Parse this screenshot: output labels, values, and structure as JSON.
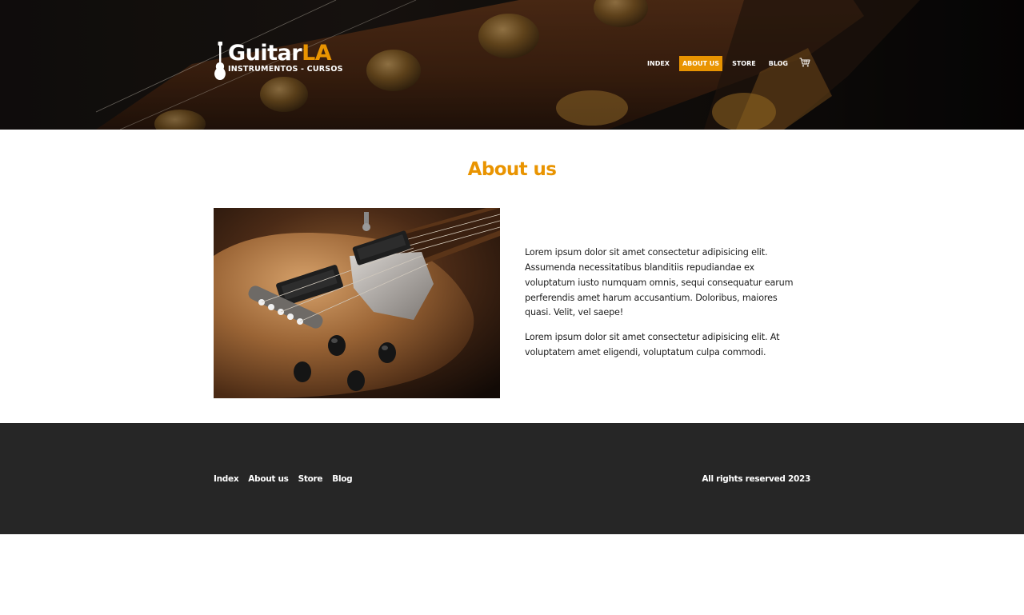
{
  "header": {
    "logo": {
      "title_main": "Guitar",
      "title_accent": "LA",
      "subtitle": "INSTRUMENTOS - CURSOS"
    },
    "nav": [
      {
        "label": "INDEX",
        "active": false
      },
      {
        "label": "ABOUT US",
        "active": true
      },
      {
        "label": "STORE",
        "active": false
      },
      {
        "label": "BLOG",
        "active": false
      }
    ],
    "cart_icon": "cart-icon"
  },
  "main": {
    "heading": "About us",
    "paragraphs": [
      "Lorem ipsum dolor sit amet consectetur adipisicing elit. Assumenda necessitatibus blanditiis repudiandae ex voluptatum iusto numquam omnis, sequi consequatur earum perferendis amet harum accusantium. Doloribus, maiores quasi. Velit, vel saepe!",
      "Lorem ipsum dolor sit amet consectetur adipisicing elit. At voluptatem amet eligendi, voluptatum culpa commodi."
    ]
  },
  "footer": {
    "nav": [
      "Index",
      "About us",
      "Store",
      "Blog"
    ],
    "copyright": "All rights reserved 2023"
  },
  "colors": {
    "accent": "#e99401",
    "footer_bg": "#262626",
    "text": "#1c1c1c"
  }
}
